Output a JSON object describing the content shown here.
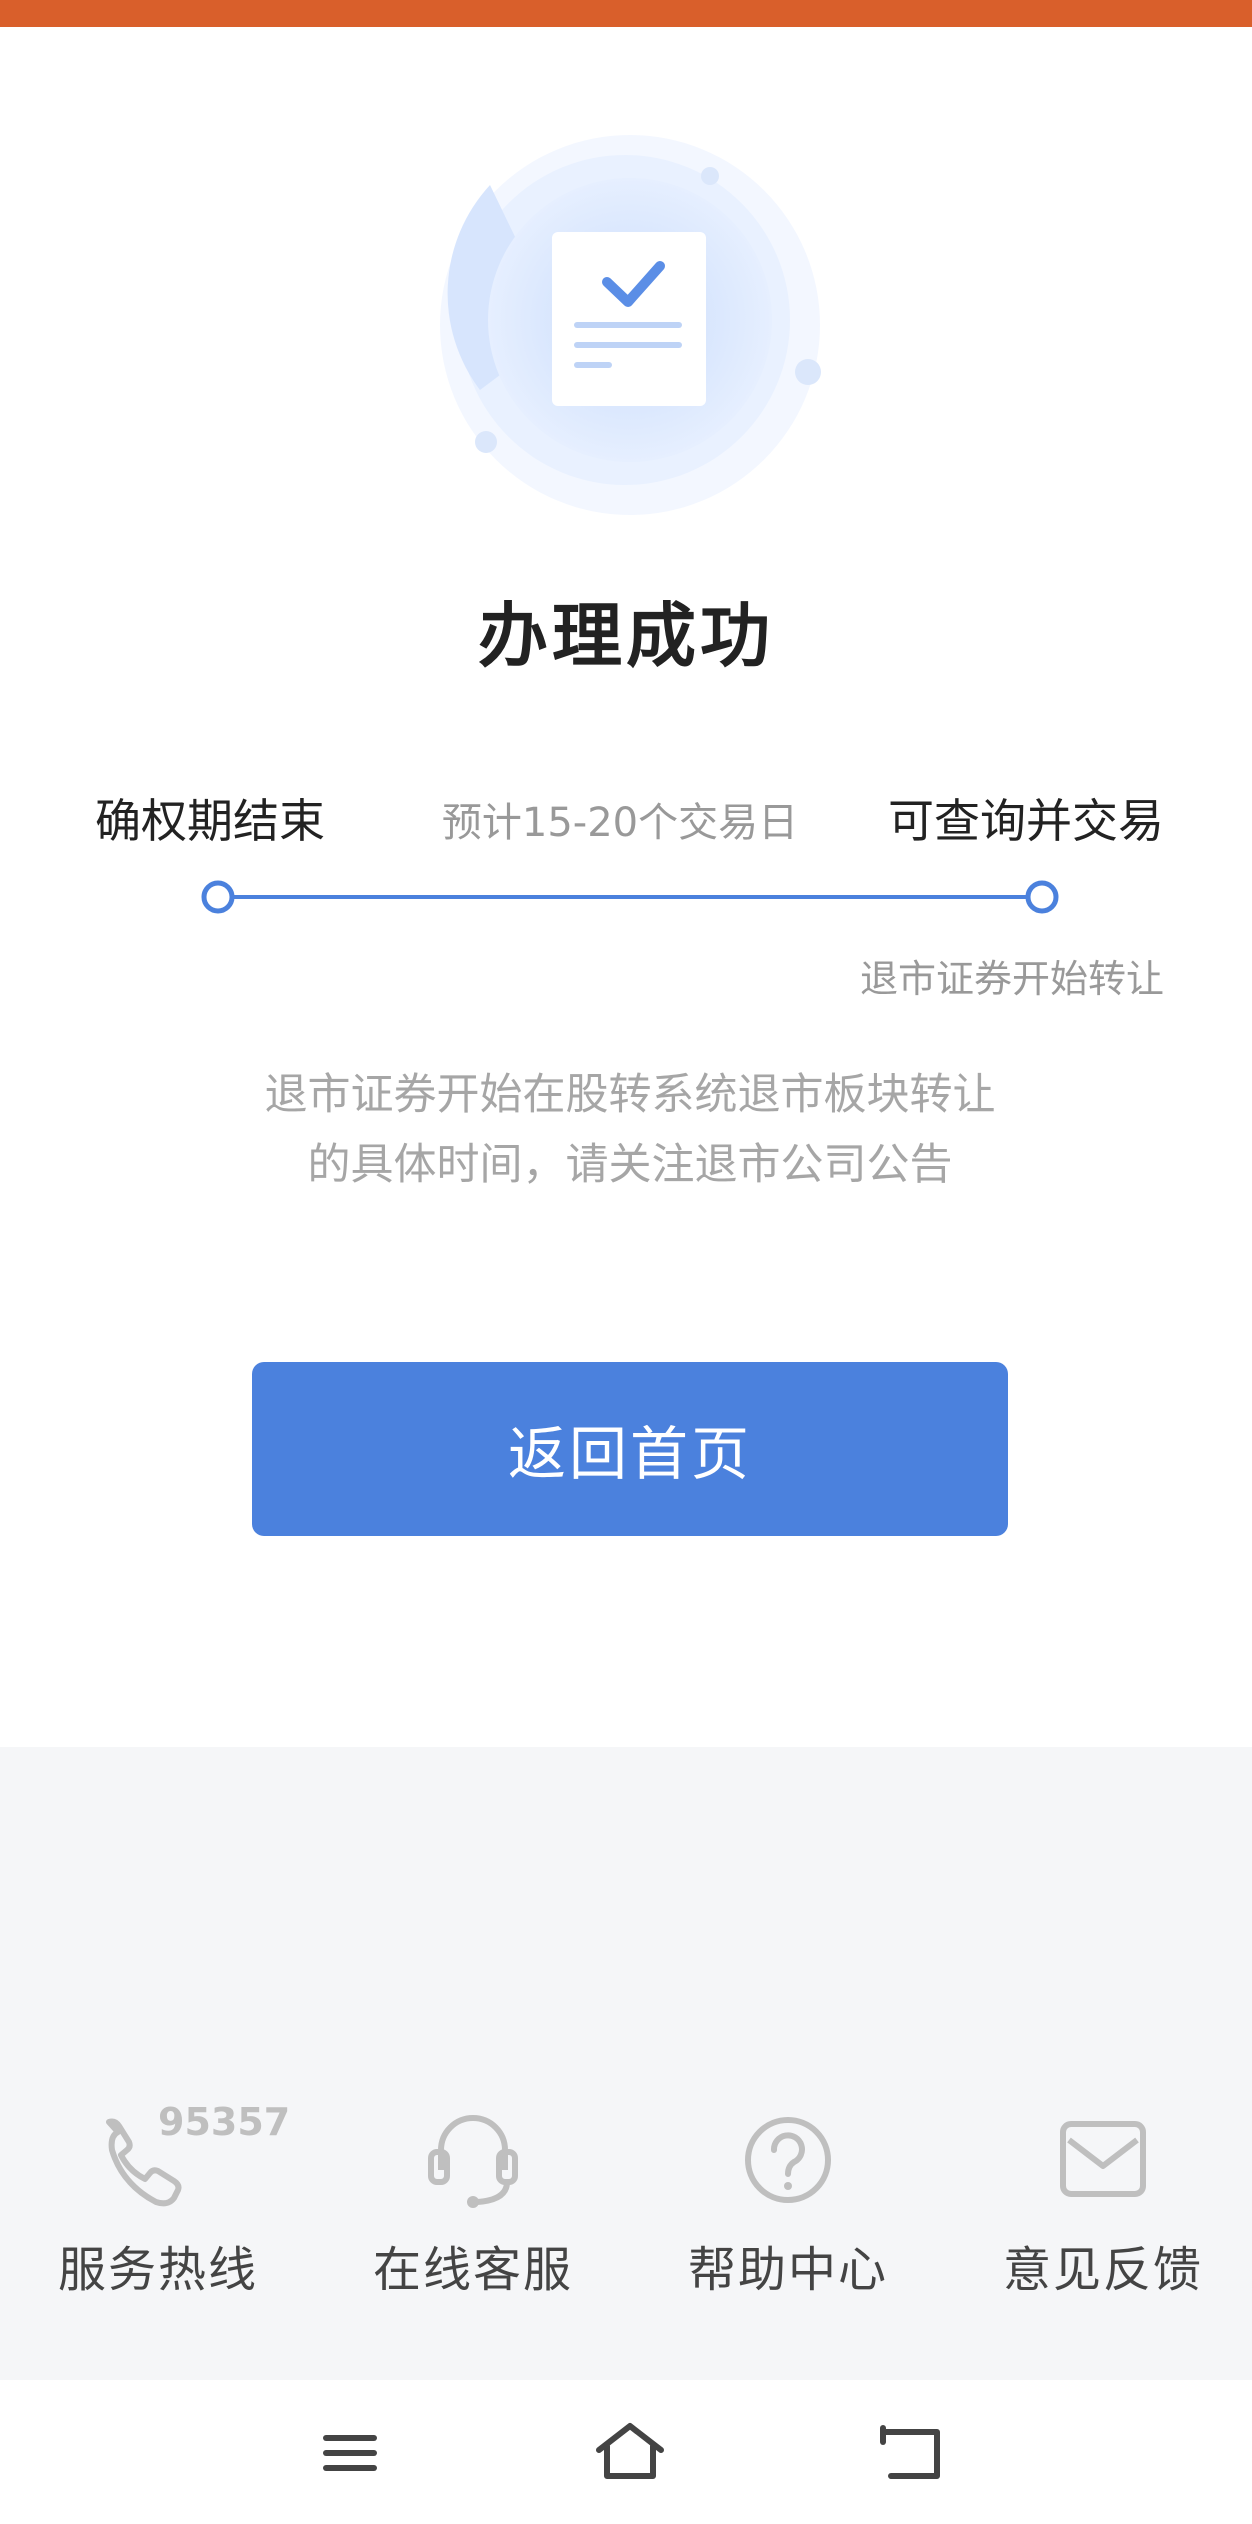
{
  "result": {
    "title": "办理成功",
    "steps": {
      "left_label": "确权期结束",
      "middle_label": "预计15-20个交易日",
      "right_label": "可查询并交易",
      "right_sub_label": "退市证券开始转让"
    },
    "description": "退市证券开始在股转系统退市板块转让的具体时间，请关注退市公司公告",
    "primary_button": "返回首页"
  },
  "footer": {
    "hotline_number": "95357",
    "items": [
      {
        "label": "服务热线",
        "icon": "phone-icon"
      },
      {
        "label": "在线客服",
        "icon": "headset-icon"
      },
      {
        "label": "帮助中心",
        "icon": "question-icon"
      },
      {
        "label": "意见反馈",
        "icon": "mail-icon"
      }
    ]
  },
  "system_nav": {
    "menu_icon": "menu-icon",
    "home_icon": "home-icon",
    "back_icon": "back-icon"
  },
  "colors": {
    "accent": "#4b81dd",
    "top_bar": "#d95f2b",
    "footer_bg": "#f5f6f8"
  }
}
